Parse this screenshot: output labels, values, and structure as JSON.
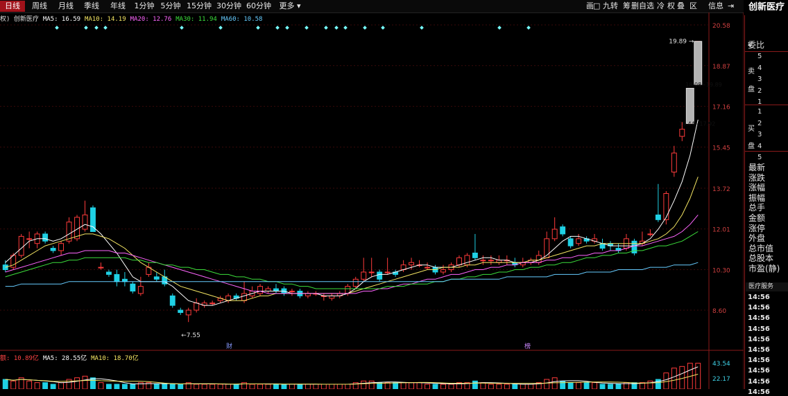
{
  "stock_name": "创新医疗",
  "period_tabs": [
    "日线",
    "周线",
    "月线",
    "季线",
    "年线",
    "1分钟",
    "5分钟",
    "15分钟",
    "30分钟",
    "60分钟",
    "更多 ▾"
  ],
  "active_tab": 0,
  "toolbar_items": [
    "画",
    "九转",
    "筹",
    "删自选",
    "冷",
    "权",
    "叠",
    "区",
    "信息",
    "⇥"
  ],
  "ma_legend": [
    {
      "text": "权) 创新医疗",
      "color": "#e0e0e0"
    },
    {
      "text": "MA5: 16.59",
      "color": "#ffffff"
    },
    {
      "text": "MA10: 14.19",
      "color": "#f5e663"
    },
    {
      "text": "MA20: 12.76",
      "color": "#ff66ff"
    },
    {
      "text": "MA30: 11.94",
      "color": "#3ce03c"
    },
    {
      "text": "MA60: 10.58",
      "color": "#66ccff"
    }
  ],
  "vol_legend": [
    {
      "text": "额: 10.89亿",
      "color": "#ff4444"
    },
    {
      "text": "MA5: 28.55亿",
      "color": "#ffffff"
    },
    {
      "text": "MA10: 18.70亿",
      "color": "#f5e663"
    }
  ],
  "vol_axis": [
    "43.54",
    "22.17"
  ],
  "right_panel": {
    "weibi_label": "委比",
    "sell_label": "卖盘",
    "sell_chars": [
      "¥",
      "卖",
      "盘"
    ],
    "buy_chars": [
      "买",
      "盘"
    ],
    "sell_levels": [
      "5",
      "4",
      "3",
      "2",
      "1"
    ],
    "buy_levels": [
      "1",
      "2",
      "3",
      "4",
      "5"
    ],
    "fields": [
      "最新",
      "涨跌",
      "涨幅",
      "振幅",
      "总手",
      "金额",
      "涨停",
      "外盘",
      "总市值",
      "总股本",
      "市盈(静)"
    ],
    "section_title": "医疗服务",
    "times": [
      "14:56",
      "14:56",
      "14:56",
      "14:56",
      "14:56",
      "14:56",
      "14:56",
      "14:56",
      "14:56",
      "14:56"
    ]
  },
  "chart_data": {
    "type": "candlestick",
    "price_axis": [
      20.58,
      18.87,
      17.16,
      15.45,
      13.72,
      12.01,
      10.3,
      8.6
    ],
    "ylim": [
      8.6,
      20.58
    ],
    "annotations": [
      {
        "text": "19.89",
        "price": 19.89
      },
      {
        "text": "18.08~19.89",
        "price": 18.08
      },
      {
        "text": "16.44~17.92",
        "price": 16.44
      },
      {
        "text": "←7.55",
        "price": 7.55
      }
    ],
    "markers": [
      "财",
      "榜"
    ],
    "candles": [
      [
        10.5,
        10.3,
        10.7,
        10.2
      ],
      [
        10.4,
        10.9,
        11.0,
        10.3
      ],
      [
        10.9,
        11.7,
        11.8,
        10.8
      ],
      [
        11.6,
        11.6,
        11.9,
        11.2
      ],
      [
        11.4,
        11.8,
        11.9,
        11.2
      ],
      [
        11.8,
        11.5,
        11.9,
        11.4
      ],
      [
        11.2,
        11.1,
        11.3,
        11.0
      ],
      [
        11.1,
        11.4,
        11.5,
        10.9
      ],
      [
        11.5,
        12.3,
        12.5,
        11.4
      ],
      [
        11.6,
        12.5,
        12.6,
        11.5
      ],
      [
        12.0,
        12.6,
        13.2,
        11.9
      ],
      [
        12.9,
        11.9,
        13.0,
        11.9
      ],
      [
        10.4,
        10.4,
        10.6,
        10.3
      ],
      [
        10.2,
        10.1,
        10.3,
        10.0
      ],
      [
        10.1,
        9.8,
        10.3,
        9.6
      ],
      [
        9.9,
        9.8,
        10.2,
        9.6
      ],
      [
        9.7,
        9.4,
        9.8,
        9.3
      ],
      [
        9.3,
        9.6,
        10.0,
        9.2
      ],
      [
        10.1,
        10.4,
        10.6,
        10.0
      ],
      [
        10.0,
        9.9,
        10.2,
        9.8
      ],
      [
        10.0,
        9.7,
        10.3,
        9.6
      ],
      [
        9.2,
        8.8,
        9.3,
        8.7
      ],
      [
        8.6,
        8.5,
        8.7,
        8.4
      ],
      [
        8.4,
        8.6,
        8.7,
        8.1
      ],
      [
        8.6,
        8.9,
        9.1,
        8.5
      ],
      [
        8.8,
        8.9,
        9.0,
        8.7
      ],
      [
        8.9,
        8.9,
        9.0,
        8.8
      ],
      [
        9.0,
        9.1,
        9.2,
        8.9
      ],
      [
        9.0,
        9.2,
        9.3,
        8.9
      ],
      [
        9.2,
        9.1,
        9.3,
        9.0
      ],
      [
        9.0,
        9.3,
        9.8,
        8.9
      ],
      [
        9.2,
        9.4,
        9.6,
        9.1
      ],
      [
        9.3,
        9.6,
        9.7,
        9.2
      ],
      [
        9.4,
        9.5,
        9.6,
        9.3
      ],
      [
        9.5,
        9.4,
        9.7,
        9.3
      ],
      [
        9.5,
        9.3,
        9.6,
        9.2
      ],
      [
        9.4,
        9.4,
        9.5,
        9.2
      ],
      [
        9.4,
        9.2,
        9.5,
        9.1
      ],
      [
        9.2,
        9.3,
        9.4,
        9.1
      ],
      [
        9.3,
        9.3,
        9.4,
        9.2
      ],
      [
        9.2,
        9.2,
        9.3,
        9.0
      ],
      [
        9.1,
        9.2,
        9.3,
        9.0
      ],
      [
        9.2,
        9.3,
        9.4,
        9.1
      ],
      [
        9.3,
        9.6,
        9.7,
        9.2
      ],
      [
        9.6,
        9.9,
        10.0,
        9.5
      ],
      [
        9.9,
        10.2,
        10.8,
        9.8
      ],
      [
        10.2,
        10.2,
        10.8,
        10.0
      ],
      [
        10.2,
        9.9,
        10.3,
        9.8
      ],
      [
        10.2,
        10.2,
        10.8,
        10.1
      ],
      [
        10.2,
        10.1,
        10.3,
        10.0
      ],
      [
        10.3,
        10.5,
        10.7,
        10.2
      ],
      [
        10.5,
        10.6,
        10.8,
        10.3
      ],
      [
        10.5,
        10.5,
        10.7,
        10.4
      ],
      [
        10.4,
        10.4,
        10.6,
        10.3
      ],
      [
        10.4,
        10.2,
        10.5,
        10.1
      ],
      [
        10.2,
        10.3,
        10.5,
        10.1
      ],
      [
        10.3,
        10.5,
        10.6,
        10.2
      ],
      [
        10.5,
        10.8,
        10.9,
        10.4
      ],
      [
        10.5,
        10.9,
        11.0,
        10.4
      ],
      [
        11.0,
        10.8,
        11.8,
        10.7
      ],
      [
        10.7,
        10.7,
        10.9,
        10.5
      ],
      [
        10.7,
        10.7,
        10.9,
        10.5
      ],
      [
        10.6,
        10.7,
        10.9,
        10.5
      ],
      [
        10.7,
        10.7,
        10.9,
        10.5
      ],
      [
        10.6,
        10.5,
        10.8,
        10.4
      ],
      [
        10.5,
        10.6,
        10.8,
        10.4
      ],
      [
        10.6,
        10.7,
        10.8,
        10.5
      ],
      [
        10.6,
        10.9,
        11.1,
        10.5
      ],
      [
        10.8,
        11.6,
        11.9,
        10.8
      ],
      [
        11.6,
        12.0,
        12.5,
        11.5
      ],
      [
        12.1,
        11.8,
        12.2,
        11.7
      ],
      [
        11.6,
        11.3,
        11.7,
        11.2
      ],
      [
        11.4,
        11.6,
        11.8,
        11.3
      ],
      [
        11.6,
        11.5,
        11.7,
        11.4
      ],
      [
        11.5,
        11.6,
        11.8,
        11.4
      ],
      [
        11.4,
        11.2,
        11.6,
        11.1
      ],
      [
        11.4,
        11.3,
        11.5,
        11.1
      ],
      [
        11.2,
        11.1,
        11.4,
        11.0
      ],
      [
        11.2,
        11.6,
        11.8,
        11.1
      ],
      [
        11.5,
        11.0,
        11.6,
        10.9
      ],
      [
        11.4,
        11.5,
        11.9,
        11.3
      ],
      [
        11.8,
        11.8,
        12.0,
        11.7
      ],
      [
        12.6,
        12.4,
        13.9,
        12.3
      ],
      [
        12.4,
        13.5,
        13.6,
        12.2
      ],
      [
        14.4,
        15.2,
        15.5,
        14.2
      ],
      [
        15.9,
        16.2,
        16.5,
        15.7
      ],
      [
        16.44,
        17.92,
        17.92,
        16.44
      ],
      [
        18.08,
        19.89,
        19.89,
        18.08
      ]
    ],
    "ma_lines": [
      {
        "name": "MA5",
        "color": "#ffffff",
        "values": [
          10.6,
          10.9,
          11.2,
          11.5,
          11.6,
          11.6,
          11.5,
          11.6,
          11.8,
          12.0,
          12.2,
          12.1,
          11.8,
          11.4,
          11.0,
          10.5,
          10.0,
          9.8,
          9.8,
          9.8,
          9.8,
          9.6,
          9.3,
          9.0,
          8.9,
          8.8,
          8.8,
          8.9,
          9.0,
          9.1,
          9.2,
          9.3,
          9.4,
          9.4,
          9.4,
          9.4,
          9.3,
          9.3,
          9.3,
          9.3,
          9.2,
          9.2,
          9.2,
          9.3,
          9.5,
          9.8,
          10.0,
          10.1,
          10.1,
          10.2,
          10.3,
          10.4,
          10.5,
          10.5,
          10.4,
          10.4,
          10.4,
          10.5,
          10.6,
          10.7,
          10.8,
          10.8,
          10.7,
          10.7,
          10.6,
          10.6,
          10.6,
          10.7,
          10.9,
          11.2,
          11.5,
          11.7,
          11.7,
          11.6,
          11.5,
          11.4,
          11.3,
          11.3,
          11.3,
          11.3,
          11.4,
          11.6,
          12.0,
          12.5,
          13.2,
          14.0,
          15.1,
          16.6
        ]
      },
      {
        "name": "MA10",
        "color": "#f5e663",
        "values": [
          10.4,
          10.5,
          10.7,
          10.9,
          11.1,
          11.3,
          11.4,
          11.5,
          11.6,
          11.7,
          11.8,
          11.8,
          11.7,
          11.6,
          11.4,
          11.2,
          10.9,
          10.6,
          10.4,
          10.2,
          10.0,
          9.8,
          9.6,
          9.5,
          9.4,
          9.3,
          9.2,
          9.1,
          9.0,
          9.0,
          9.0,
          9.1,
          9.2,
          9.2,
          9.3,
          9.3,
          9.3,
          9.3,
          9.3,
          9.3,
          9.3,
          9.3,
          9.3,
          9.3,
          9.4,
          9.5,
          9.6,
          9.7,
          9.8,
          9.9,
          10.0,
          10.1,
          10.2,
          10.3,
          10.3,
          10.4,
          10.4,
          10.4,
          10.5,
          10.5,
          10.6,
          10.6,
          10.6,
          10.6,
          10.6,
          10.6,
          10.7,
          10.7,
          10.8,
          10.9,
          11.0,
          11.1,
          11.2,
          11.3,
          11.3,
          11.4,
          11.4,
          11.4,
          11.4,
          11.4,
          11.4,
          11.5,
          11.6,
          11.8,
          12.1,
          12.6,
          13.3,
          14.2
        ]
      },
      {
        "name": "MA20",
        "color": "#ff66ff",
        "values": [
          10.2,
          10.3,
          10.4,
          10.5,
          10.6,
          10.7,
          10.8,
          10.9,
          11.0,
          11.0,
          11.1,
          11.1,
          11.1,
          11.1,
          11.0,
          11.0,
          10.9,
          10.8,
          10.7,
          10.6,
          10.5,
          10.4,
          10.3,
          10.2,
          10.1,
          10.0,
          9.9,
          9.8,
          9.7,
          9.6,
          9.5,
          9.4,
          9.4,
          9.3,
          9.3,
          9.3,
          9.3,
          9.3,
          9.3,
          9.3,
          9.3,
          9.3,
          9.3,
          9.3,
          9.3,
          9.4,
          9.4,
          9.5,
          9.5,
          9.6,
          9.7,
          9.7,
          9.8,
          9.9,
          9.9,
          10.0,
          10.1,
          10.1,
          10.2,
          10.3,
          10.3,
          10.4,
          10.4,
          10.5,
          10.5,
          10.6,
          10.6,
          10.6,
          10.7,
          10.7,
          10.8,
          10.8,
          10.9,
          10.9,
          11.0,
          11.0,
          11.1,
          11.1,
          11.2,
          11.3,
          11.3,
          11.4,
          11.5,
          11.6,
          11.7,
          11.9,
          12.2,
          12.6
        ]
      },
      {
        "name": "MA30",
        "color": "#3ce03c",
        "values": [
          10.0,
          10.1,
          10.2,
          10.3,
          10.4,
          10.5,
          10.6,
          10.6,
          10.7,
          10.7,
          10.8,
          10.8,
          10.8,
          10.8,
          10.8,
          10.8,
          10.7,
          10.7,
          10.6,
          10.6,
          10.5,
          10.5,
          10.4,
          10.4,
          10.3,
          10.3,
          10.2,
          10.1,
          10.1,
          10.0,
          10.0,
          9.9,
          9.9,
          9.8,
          9.8,
          9.7,
          9.7,
          9.6,
          9.6,
          9.5,
          9.5,
          9.5,
          9.5,
          9.5,
          9.5,
          9.5,
          9.5,
          9.5,
          9.6,
          9.6,
          9.6,
          9.7,
          9.7,
          9.7,
          9.8,
          9.8,
          9.9,
          9.9,
          10.0,
          10.0,
          10.1,
          10.1,
          10.2,
          10.2,
          10.3,
          10.3,
          10.4,
          10.4,
          10.5,
          10.5,
          10.6,
          10.6,
          10.7,
          10.8,
          10.8,
          10.9,
          10.9,
          11.0,
          11.0,
          11.1,
          11.1,
          11.2,
          11.3,
          11.3,
          11.4,
          11.5,
          11.7,
          11.9
        ]
      },
      {
        "name": "MA60",
        "color": "#66ccff",
        "values": [
          9.6,
          9.6,
          9.7,
          9.7,
          9.7,
          9.7,
          9.7,
          9.7,
          9.8,
          9.8,
          9.8,
          9.8,
          9.8,
          9.8,
          9.8,
          9.8,
          9.8,
          9.8,
          9.8,
          9.8,
          9.8,
          9.8,
          9.8,
          9.8,
          9.8,
          9.8,
          9.8,
          9.8,
          9.8,
          9.8,
          9.8,
          9.8,
          9.8,
          9.8,
          9.8,
          9.8,
          9.8,
          9.8,
          9.8,
          9.8,
          9.8,
          9.8,
          9.8,
          9.8,
          9.8,
          9.8,
          9.8,
          9.8,
          9.8,
          9.8,
          9.8,
          9.8,
          9.8,
          9.8,
          9.8,
          9.8,
          9.9,
          9.9,
          9.9,
          9.9,
          9.9,
          9.9,
          9.9,
          10.0,
          10.0,
          10.0,
          10.0,
          10.0,
          10.0,
          10.1,
          10.1,
          10.1,
          10.1,
          10.2,
          10.2,
          10.2,
          10.2,
          10.3,
          10.3,
          10.3,
          10.3,
          10.4,
          10.4,
          10.4,
          10.5,
          10.5,
          10.5,
          10.6
        ]
      }
    ],
    "volumes": [
      6,
      5,
      7,
      5,
      4,
      4,
      3,
      4,
      6,
      7,
      8,
      7,
      4,
      3,
      3,
      3,
      3,
      4,
      4,
      3,
      3,
      3,
      3,
      4,
      3,
      3,
      3,
      3,
      3,
      3,
      4,
      3,
      3,
      3,
      3,
      3,
      3,
      3,
      3,
      3,
      3,
      3,
      3,
      3,
      4,
      5,
      5,
      4,
      4,
      4,
      4,
      4,
      4,
      3,
      3,
      3,
      3,
      4,
      4,
      5,
      4,
      3,
      3,
      3,
      3,
      3,
      3,
      4,
      6,
      7,
      5,
      4,
      4,
      4,
      4,
      3,
      3,
      3,
      4,
      4,
      4,
      5,
      6,
      10,
      13,
      14,
      16,
      16
    ]
  }
}
